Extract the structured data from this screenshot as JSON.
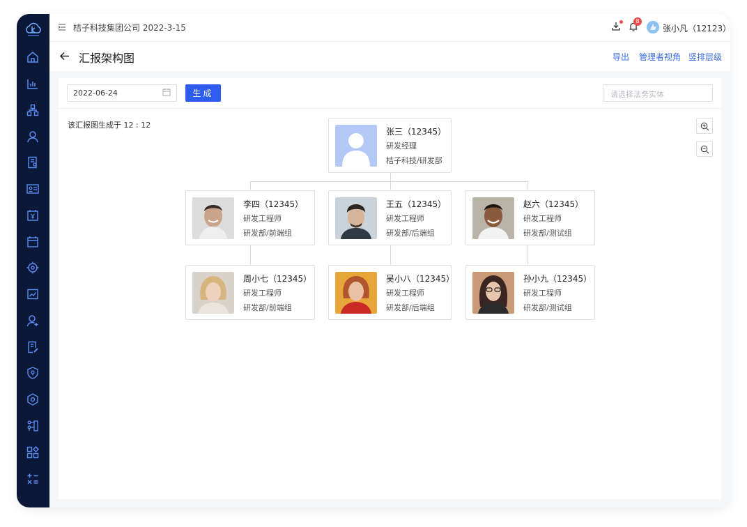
{
  "topbar": {
    "company": "桔子科技集团公司 2022-3-15",
    "notification_count": "8",
    "user_name": "张小凡（12123）"
  },
  "header": {
    "title": "汇报架构图",
    "links": [
      "导出",
      "管理者视角",
      "竖排层级"
    ]
  },
  "toolbar": {
    "date_value": "2022-06-24",
    "generate_label": "生成",
    "entity_placeholder": "请选择法务实体"
  },
  "generated_note": "该汇报图生成于 12 : 12",
  "sidebar": {
    "icons": [
      "home-icon",
      "bar-chart-icon",
      "org-structure-icon",
      "user-icon",
      "document-user-icon",
      "id-card-icon",
      "calendar-yen-icon",
      "calendar-icon",
      "target-icon",
      "trend-chart-icon",
      "user-add-icon",
      "document-edit-icon",
      "shield-icon",
      "hexagon-settings-icon",
      "flow-icon",
      "apps-icon",
      "calculator-icon"
    ]
  },
  "org": {
    "root": {
      "name": "张三（12345）",
      "role": "研发经理",
      "dept": "桔子科技/研发部",
      "photo": "placeholder-avatar"
    },
    "level2": [
      {
        "name": "李四（12345）",
        "role": "研发工程师",
        "dept": "研发部/前端组"
      },
      {
        "name": "王五（12345）",
        "role": "研发工程师",
        "dept": "研发部/后端组"
      },
      {
        "name": "赵六（12345）",
        "role": "研发工程师",
        "dept": "研发部/测试组"
      }
    ],
    "level3": [
      {
        "name": "周小七（12345）",
        "role": "研发工程师",
        "dept": "研发部/前端组"
      },
      {
        "name": "吴小八（12345）",
        "role": "研发工程师",
        "dept": "研发部/后端组"
      },
      {
        "name": "孙小九（12345）",
        "role": "研发工程师",
        "dept": "研发部/测试组"
      }
    ]
  },
  "colors": {
    "sidebar_bg": "#0b1838",
    "accent": "#2e5bf0",
    "link": "#3a6be0",
    "badge": "#f04a4a",
    "placeholder_avatar": "#b3c8f7"
  }
}
